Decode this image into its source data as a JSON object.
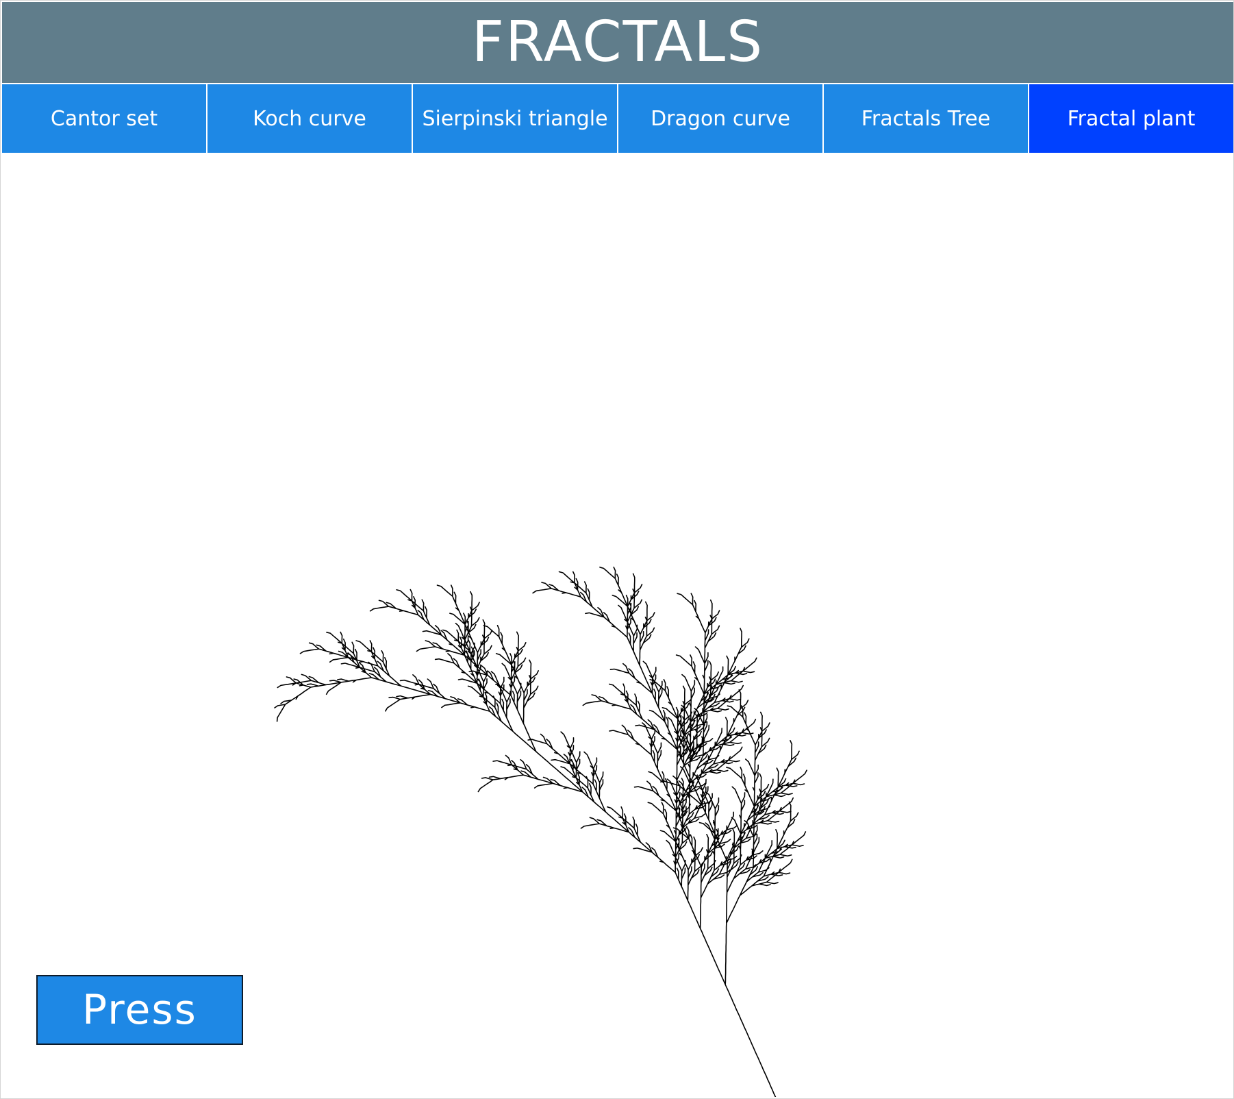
{
  "app": {
    "title": "FRACTALS"
  },
  "tabs": [
    {
      "label": "Cantor set",
      "active": false
    },
    {
      "label": "Koch curve",
      "active": false
    },
    {
      "label": "Sierpinski triangle",
      "active": false
    },
    {
      "label": "Dragon curve",
      "active": false
    },
    {
      "label": "Fractals Tree",
      "active": false
    },
    {
      "label": "Fractal plant",
      "active": true
    }
  ],
  "canvas": {
    "content": "fractal-plant-drawing"
  },
  "press_button": {
    "label": "Press"
  },
  "colors": {
    "title_bar": "#607d8b",
    "tab": "#1e88e5",
    "tab_active": "#0041ff",
    "button": "#1e88e5",
    "plant": "#000000",
    "text": "#ffffff"
  }
}
